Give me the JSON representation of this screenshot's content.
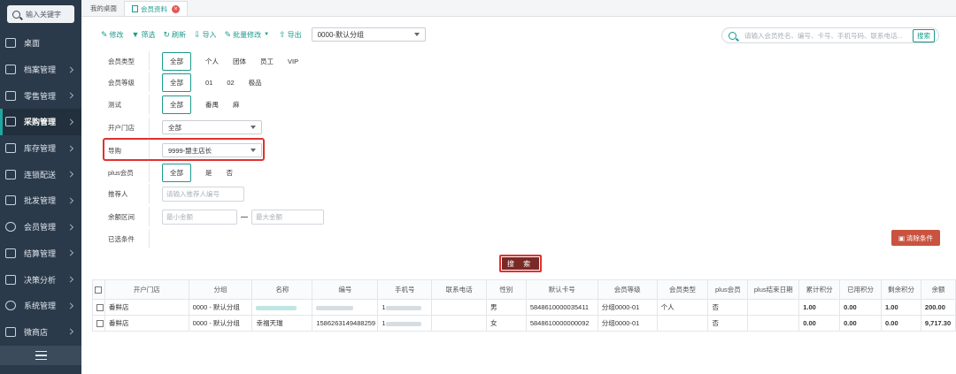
{
  "sidebar": {
    "search_placeholder": "输入关键字",
    "items": [
      {
        "label": "桌面",
        "icon": "desktop-icon"
      },
      {
        "label": "档案管理",
        "icon": "archive-icon"
      },
      {
        "label": "零售管理",
        "icon": "retail-icon"
      },
      {
        "label": "采购管理",
        "icon": "purchase-icon",
        "active": true
      },
      {
        "label": "库存管理",
        "icon": "inventory-icon"
      },
      {
        "label": "连锁配送",
        "icon": "delivery-icon"
      },
      {
        "label": "批发管理",
        "icon": "wholesale-icon"
      },
      {
        "label": "会员管理",
        "icon": "member-icon"
      },
      {
        "label": "结算管理",
        "icon": "settlement-icon"
      },
      {
        "label": "决策分析",
        "icon": "analysis-icon"
      },
      {
        "label": "系统管理",
        "icon": "system-icon"
      },
      {
        "label": "微商店",
        "icon": "shop-icon"
      }
    ]
  },
  "tabs": [
    {
      "label": "我的桌面"
    },
    {
      "label": "会员资料",
      "active": true
    }
  ],
  "toolbar": {
    "edit": "修改",
    "filter": "筛选",
    "refresh": "刷新",
    "import": "导入",
    "batch_edit": "批量修改",
    "export": "导出",
    "group_select": "0000-默认分组"
  },
  "global_search": {
    "placeholder": "请输入会员姓名、编号、卡号、手机号码、联系电话...",
    "button": "搜索"
  },
  "filters": {
    "member_type": {
      "label": "会员类型",
      "options": [
        "全部",
        "个人",
        "团体",
        "员工",
        "VIP"
      ]
    },
    "member_level": {
      "label": "会员等级",
      "options": [
        "全部",
        "01",
        "02",
        "极品"
      ]
    },
    "test": {
      "label": "测试",
      "options": [
        "全部",
        "番禺",
        "麻"
      ]
    },
    "store": {
      "label": "开户门店",
      "value": "全部"
    },
    "guide": {
      "label": "导购",
      "value": "9999-盟主店长"
    },
    "plus": {
      "label": "plus会员",
      "options": [
        "全部",
        "是",
        "否"
      ]
    },
    "referrer": {
      "label": "推荐人",
      "placeholder": "请输入推荐人编号"
    },
    "balance": {
      "label": "余额区间",
      "min_placeholder": "最小金额",
      "max_placeholder": "最大金额"
    },
    "selected": {
      "label": "已选条件"
    },
    "clear_button": "清除条件",
    "search_button": "搜 索"
  },
  "table": {
    "headers": [
      "开户门店",
      "分组",
      "名称",
      "编号",
      "手机号",
      "联系电话",
      "性别",
      "默认卡号",
      "会员等级",
      "会员类型",
      "plus会员",
      "plus结束日期",
      "累计积分",
      "已用积分",
      "剩余积分",
      "余额"
    ],
    "rows": [
      [
        "番鲜店",
        "0000 - 默认分组",
        "",
        "",
        "1",
        "",
        "男",
        "5848610000035411",
        "分组0000-01",
        "个人",
        "否",
        "",
        "1.00",
        "0.00",
        "1.00",
        "200.00"
      ],
      [
        "番鲜店",
        "0000 - 默认分组",
        "幸福天瑞",
        "1586263149488259",
        "1",
        "",
        "女",
        "5848610000000092",
        "分组0000-01",
        "",
        "否",
        "",
        "0.00",
        "0.00",
        "0.00",
        "9,717.30"
      ]
    ]
  },
  "colors": {
    "accent": "#1a9b8c",
    "sidebar_bg": "#2b3a4a",
    "highlight": "#e0322f",
    "clear_button": "#c9533f"
  }
}
